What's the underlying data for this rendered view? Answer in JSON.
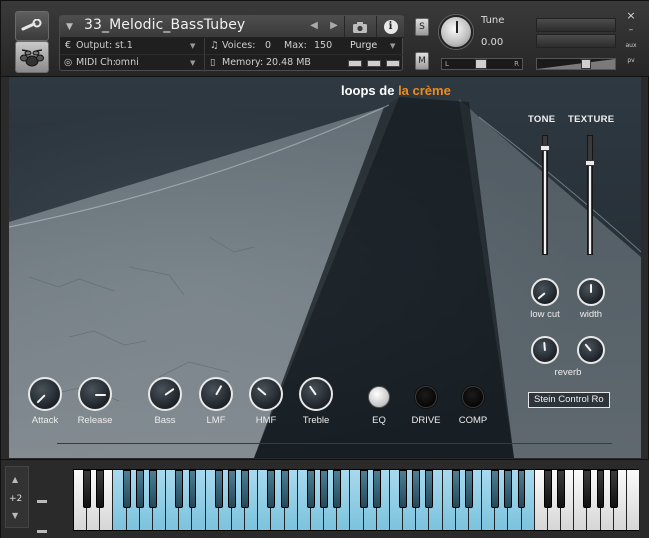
{
  "header": {
    "instrument_name": "33_Melodic_BassTubey",
    "output_label": "Output:",
    "output_value": "st.1",
    "voices_label": "Voices:",
    "voices_value": "0",
    "max_label": "Max:",
    "max_value": "150",
    "purge_label": "Purge",
    "midi_label": "MIDI Ch:",
    "midi_value": "omni",
    "memory_label": "Memory:",
    "memory_value": "20.48 MB",
    "solo_label": "S",
    "mute_label": "M",
    "tune_label": "Tune",
    "tune_value": "0.00",
    "pan_left": "L",
    "pan_right": "R",
    "aux_label": "aux",
    "pv_label": "pv",
    "close_glyph": "×",
    "minimize_glyph": "–",
    "icons": [
      "wrench-icon",
      "drum-kit-icon",
      "camera-icon",
      "info-icon",
      "prev-arrow-icon",
      "next-arrow-icon"
    ]
  },
  "instrument": {
    "brand_part1": "loops de ",
    "brand_part2": "la crème",
    "brand_accent_color": "#ef8a1b",
    "faders": [
      {
        "label": "TONE",
        "level": 0.92
      },
      {
        "label": "TEXTURE",
        "level": 0.8
      }
    ],
    "side_knobs": [
      {
        "label": "low cut"
      },
      {
        "label": "width"
      },
      {
        "label": "reverb"
      }
    ],
    "bottom_knobs": [
      {
        "label": "Attack"
      },
      {
        "label": "Release"
      },
      {
        "label": "Bass"
      },
      {
        "label": "LMF"
      },
      {
        "label": "HMF"
      },
      {
        "label": "Treble"
      }
    ],
    "toggles": [
      {
        "label": "EQ",
        "on": true
      },
      {
        "label": "DRIVE",
        "on": false
      },
      {
        "label": "COMP",
        "on": false
      }
    ],
    "preset_text": "Stein Control Ro"
  },
  "keyboard": {
    "octave_shift": "+2",
    "octave_up_glyph": "▲",
    "octave_down_glyph": "▼",
    "highlight_color": "#7cc3dd"
  }
}
